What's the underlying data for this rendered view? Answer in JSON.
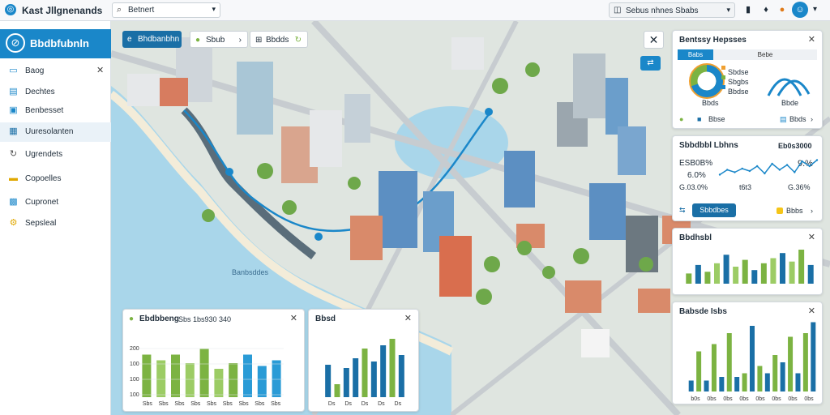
{
  "header": {
    "app_icon": "logo-icon",
    "app_title": "Kast Jllgnenands",
    "search": {
      "value": "Betnert"
    },
    "filter": {
      "value": "Sebus nhnes Sbabs"
    },
    "icons": [
      "notification-icon",
      "bell-icon",
      "alert-icon",
      "globe-icon",
      "user-avatar-icon"
    ]
  },
  "sidebar": {
    "brand_title": "Bbdbfubnln",
    "items": [
      {
        "label": "Baog",
        "icon": "map-icon"
      },
      {
        "label": "Dechtes",
        "icon": "document-icon"
      },
      {
        "label": "Benbesset",
        "icon": "layers-icon"
      },
      {
        "label": "Uuresolanten",
        "icon": "grid-icon"
      },
      {
        "label": "Ugrendets",
        "icon": "refresh-icon"
      },
      {
        "label": "Copoelles",
        "icon": "folder-icon"
      },
      {
        "label": "Cupronet",
        "icon": "chart-icon"
      },
      {
        "label": "Sepsleal",
        "icon": "settings-icon"
      }
    ]
  },
  "map": {
    "chips": [
      {
        "label": "Bhdbanbhn",
        "icon": "e"
      },
      {
        "label": "Sbub",
        "end": "›"
      },
      {
        "label": "Bbdds",
        "icon": "⊞"
      }
    ],
    "label": "Banbsddes"
  },
  "panels": {
    "top_right": {
      "title": "Bentssy Hepsses",
      "tab_selected": "Babs",
      "tab_other": "Bebe",
      "donut_caption": "Bbds",
      "legend": [
        "Sbdse",
        "Sbgbs",
        "Bbdse"
      ],
      "arc_caption": "Bbde",
      "footer_left": "Bbse",
      "footer_right": "Bbds",
      "donut": [
        0.7,
        0.3
      ],
      "colors": {
        "primary": "#1a87c9",
        "secondary": "#7cb342",
        "accent": "#f0a030"
      }
    },
    "trend": {
      "title": "Sbbdbbl Lbhns",
      "value_right": "Eb0s3000",
      "stat1": "ESB0B%",
      "stat2": "6.0%",
      "stat3": "G.03.0%",
      "stat_right": "9.%",
      "axis": [
        "t6t3",
        "G.36%"
      ],
      "button": "Sbbdbes",
      "footer_icon": "Bbbs",
      "line": [
        0.35,
        0.55,
        0.45,
        0.6,
        0.5,
        0.7,
        0.4,
        0.8,
        0.55,
        0.75,
        0.45,
        0.9,
        0.7,
        0.95
      ]
    },
    "bars_right_top": {
      "title": "Bbdhsbl",
      "bars": [
        0.3,
        0.55,
        0.35,
        0.6,
        0.85,
        0.5,
        0.7,
        0.4,
        0.6,
        0.75,
        0.9,
        0.65,
        1.0,
        0.55
      ],
      "labels": [
        "Bbs",
        "Bbs",
        "Bbs",
        "Bbs",
        "Bbs",
        "Bbs"
      ]
    },
    "bars_right_bottom": {
      "title": "Babsde Isbs",
      "bars": [
        0.15,
        0.55,
        0.15,
        0.65,
        0.2,
        0.8,
        0.2,
        0.25,
        0.9,
        0.35,
        0.25,
        0.5,
        0.4,
        0.75,
        0.25,
        0.8,
        0.95
      ],
      "labels": [
        "b0s",
        "0bs",
        "0bs",
        "0bs",
        "0bs",
        "0bs",
        "0bs",
        "0bs"
      ]
    },
    "bars_bottom_left": {
      "title": "Ebdbbeng",
      "subtitle": "Sbs 1bs930 340",
      "yticks": [
        "200",
        "100",
        "100",
        "100"
      ],
      "bars": [
        0.75,
        0.65,
        0.75,
        0.6,
        0.85,
        0.5,
        0.6,
        0.75,
        0.55,
        0.65
      ],
      "labels": [
        "Sbs",
        "Sbs",
        "Sbs",
        "Sbs",
        "Sbs",
        "Sbs",
        "Sbs",
        "Sbs",
        "Sbs"
      ]
    },
    "bars_bottom_mid": {
      "title": "Bbsd",
      "bars": [
        0.5,
        0.2,
        0.45,
        0.6,
        0.75,
        0.55,
        0.8,
        0.9,
        0.65
      ],
      "labels": [
        "Ds",
        "Ds",
        "Ds",
        "Ds",
        "Ds"
      ]
    }
  }
}
